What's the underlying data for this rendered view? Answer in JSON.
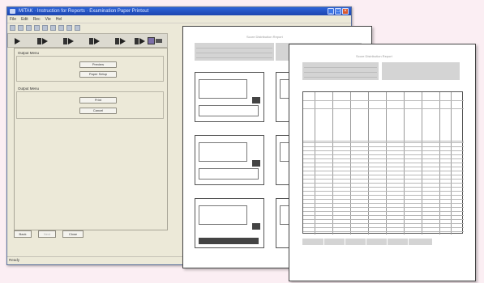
{
  "window": {
    "title": "MiTAK · Instruction for Reports · Examination Paper Printout",
    "menu": [
      "File",
      "Edit",
      "Rec",
      "Vie",
      "Hel"
    ],
    "status": "Ready"
  },
  "panel": {
    "output_group_label": "Output Menu",
    "output_buttons": [
      "Preview",
      "Paper Setup"
    ],
    "other_group_label": "Output Menu",
    "other_buttons": [
      "Print",
      "Cancel"
    ]
  },
  "footer": {
    "buttons": [
      "Back",
      "Next",
      "Close"
    ]
  },
  "sheets": {
    "front_title": "Score Distribution Report",
    "back_title": "Score Distribution Report"
  },
  "colors": {
    "title_bar": "#1d46b0",
    "window_face": "#ece9d8",
    "background": "#fbeef3"
  }
}
